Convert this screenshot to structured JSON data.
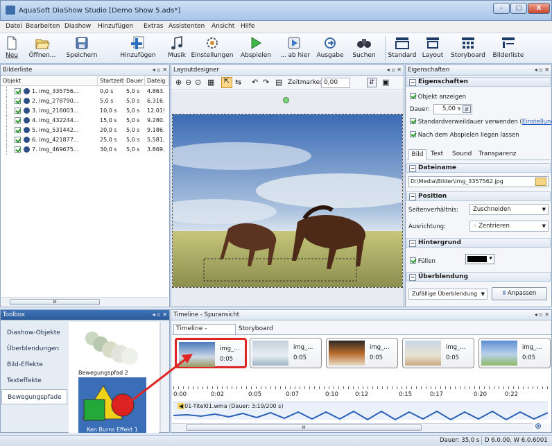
{
  "window": {
    "title": "AquaSoft DiaShow Studio [Demo Show 5.ads*]",
    "min": "–",
    "max": "□",
    "close": "X"
  },
  "menu": [
    "Datei",
    "Bearbeiten",
    "Diashow",
    "Hinzufügen",
    "Extras",
    "Assistenten",
    "Ansicht",
    "Hilfe"
  ],
  "toolbar": {
    "neu": "Neu",
    "oeffnen": "Öffnen...",
    "speichern": "Speichern",
    "hinzufuegen": "Hinzufügen",
    "musik": "Musik",
    "einstellungen": "Einstellungen",
    "abspielen": "Abspielen",
    "abhier": "... ab hier",
    "ausgabe": "Ausgabe",
    "suchen": "Suchen",
    "standard": "Standard",
    "layout": "Layout",
    "storyboard": "Storyboard",
    "bilderliste": "Bilderliste"
  },
  "bilderliste": {
    "title": "Bilderliste",
    "columns": [
      "Objekt",
      "Startzeit",
      "Dauer",
      "Dateig"
    ],
    "rows": [
      {
        "name": "1. img_335756...",
        "start": "0,0 s",
        "dur": "5,0 s",
        "size": "4.863."
      },
      {
        "name": "2. img_278790...",
        "start": "5,0 s",
        "dur": "5,0 s",
        "size": "6.316."
      },
      {
        "name": "3. img_216003...",
        "start": "10,0 s",
        "dur": "5,0 s",
        "size": "12.01!"
      },
      {
        "name": "4. img_432244...",
        "start": "15,0 s",
        "dur": "5,0 s",
        "size": "9.280."
      },
      {
        "name": "5. img_531442...",
        "start": "20,0 s",
        "dur": "5,0 s",
        "size": "9.186."
      },
      {
        "name": "6. img_421877...",
        "start": "25,0 s",
        "dur": "5,0 s",
        "size": "5.581."
      },
      {
        "name": "7. img_469675...",
        "start": "30,0 s",
        "dur": "5,0 s",
        "size": "3.869."
      }
    ],
    "hscroll": "III"
  },
  "layout": {
    "title": "Layoutdesigner",
    "zeitmarke_label": "Zeitmarke:",
    "zeitmarke_value": "0,00"
  },
  "props": {
    "title": "Eigenschaften",
    "section": "Eigenschaften",
    "objekt_anzeigen": "Objekt anzeigen",
    "dauer_label": "Dauer:",
    "dauer_value": "5,00 s",
    "std_text": "Standardverweildauer verwenden (",
    "std_link": "Einstellungen",
    "std_close": ")",
    "liegen": "Nach dem Abspielen liegen lassen",
    "tabs": [
      "Bild",
      "Text",
      "Sound",
      "Transparenz"
    ],
    "dateiname_h": "Dateiname",
    "dateiname": "D:\\Media\\Bilder\\img_3357562.jpg",
    "position_h": "Position",
    "seiten_label": "Seitenverhältnis:",
    "seiten_value": "Zuschneiden",
    "ausr_label": "Ausrichtung:",
    "ausr_value": "Zentrieren",
    "hintergrund_h": "Hintergrund",
    "fuellen": "Füllen",
    "fill_color": "#000000",
    "ueberblendung_h": "Überblendung",
    "ueberblendung_value": "Zufällige Überblendung",
    "anpassen": "Anpassen"
  },
  "toolbox": {
    "title": "Toolbox",
    "items": [
      "Diashow-Objekte",
      "Überblendungen",
      "Bild-Effekte",
      "Texteffekte",
      "Bewegungspfade"
    ],
    "effect1": "Bewegungspfad 2",
    "effect2": "Ken Burns Effekt 1"
  },
  "timeline": {
    "title": "Timeline - Spuransicht",
    "tabs": [
      "Timeline - Spuransicht",
      "Storyboard"
    ],
    "thumbs": [
      {
        "name": "img_...",
        "dur": "0:05"
      },
      {
        "name": "img_...",
        "dur": "0:05"
      },
      {
        "name": "img_...",
        "dur": "0:05"
      },
      {
        "name": "img_...",
        "dur": "0:05"
      },
      {
        "name": "img_...",
        "dur": "0:05"
      }
    ],
    "ruler": [
      "0:00",
      "0:02",
      "0:05",
      "0:07",
      "0:10",
      "0:12",
      "0:15",
      "0:17",
      "0:20",
      "0:22"
    ],
    "audio": "01-Titel01.wma (Dauer: 3:19/200 s)",
    "hscroll": "III"
  },
  "status": {
    "dauer": "Dauer: 35,0 s",
    "version": "D 6.0.00, W 6.0.6001"
  },
  "colors": {
    "accent": "#3c6fb0",
    "highlight": "#e02424",
    "selection": "#a8c8ee"
  }
}
